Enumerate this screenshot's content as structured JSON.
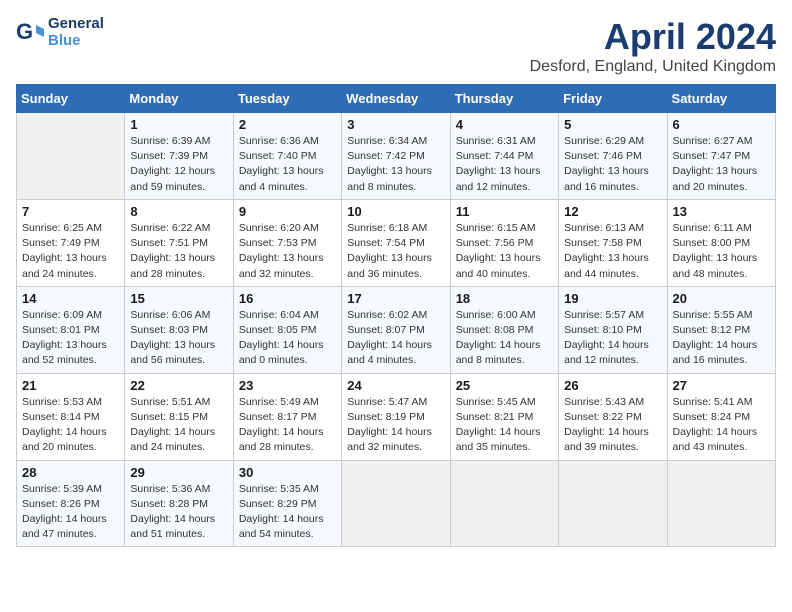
{
  "header": {
    "logo_line1": "General",
    "logo_line2": "Blue",
    "title": "April 2024",
    "subtitle": "Desford, England, United Kingdom"
  },
  "weekdays": [
    "Sunday",
    "Monday",
    "Tuesday",
    "Wednesday",
    "Thursday",
    "Friday",
    "Saturday"
  ],
  "weeks": [
    [
      {
        "day": "",
        "info": ""
      },
      {
        "day": "1",
        "info": "Sunrise: 6:39 AM\nSunset: 7:39 PM\nDaylight: 12 hours\nand 59 minutes."
      },
      {
        "day": "2",
        "info": "Sunrise: 6:36 AM\nSunset: 7:40 PM\nDaylight: 13 hours\nand 4 minutes."
      },
      {
        "day": "3",
        "info": "Sunrise: 6:34 AM\nSunset: 7:42 PM\nDaylight: 13 hours\nand 8 minutes."
      },
      {
        "day": "4",
        "info": "Sunrise: 6:31 AM\nSunset: 7:44 PM\nDaylight: 13 hours\nand 12 minutes."
      },
      {
        "day": "5",
        "info": "Sunrise: 6:29 AM\nSunset: 7:46 PM\nDaylight: 13 hours\nand 16 minutes."
      },
      {
        "day": "6",
        "info": "Sunrise: 6:27 AM\nSunset: 7:47 PM\nDaylight: 13 hours\nand 20 minutes."
      }
    ],
    [
      {
        "day": "7",
        "info": "Sunrise: 6:25 AM\nSunset: 7:49 PM\nDaylight: 13 hours\nand 24 minutes."
      },
      {
        "day": "8",
        "info": "Sunrise: 6:22 AM\nSunset: 7:51 PM\nDaylight: 13 hours\nand 28 minutes."
      },
      {
        "day": "9",
        "info": "Sunrise: 6:20 AM\nSunset: 7:53 PM\nDaylight: 13 hours\nand 32 minutes."
      },
      {
        "day": "10",
        "info": "Sunrise: 6:18 AM\nSunset: 7:54 PM\nDaylight: 13 hours\nand 36 minutes."
      },
      {
        "day": "11",
        "info": "Sunrise: 6:15 AM\nSunset: 7:56 PM\nDaylight: 13 hours\nand 40 minutes."
      },
      {
        "day": "12",
        "info": "Sunrise: 6:13 AM\nSunset: 7:58 PM\nDaylight: 13 hours\nand 44 minutes."
      },
      {
        "day": "13",
        "info": "Sunrise: 6:11 AM\nSunset: 8:00 PM\nDaylight: 13 hours\nand 48 minutes."
      }
    ],
    [
      {
        "day": "14",
        "info": "Sunrise: 6:09 AM\nSunset: 8:01 PM\nDaylight: 13 hours\nand 52 minutes."
      },
      {
        "day": "15",
        "info": "Sunrise: 6:06 AM\nSunset: 8:03 PM\nDaylight: 13 hours\nand 56 minutes."
      },
      {
        "day": "16",
        "info": "Sunrise: 6:04 AM\nSunset: 8:05 PM\nDaylight: 14 hours\nand 0 minutes."
      },
      {
        "day": "17",
        "info": "Sunrise: 6:02 AM\nSunset: 8:07 PM\nDaylight: 14 hours\nand 4 minutes."
      },
      {
        "day": "18",
        "info": "Sunrise: 6:00 AM\nSunset: 8:08 PM\nDaylight: 14 hours\nand 8 minutes."
      },
      {
        "day": "19",
        "info": "Sunrise: 5:57 AM\nSunset: 8:10 PM\nDaylight: 14 hours\nand 12 minutes."
      },
      {
        "day": "20",
        "info": "Sunrise: 5:55 AM\nSunset: 8:12 PM\nDaylight: 14 hours\nand 16 minutes."
      }
    ],
    [
      {
        "day": "21",
        "info": "Sunrise: 5:53 AM\nSunset: 8:14 PM\nDaylight: 14 hours\nand 20 minutes."
      },
      {
        "day": "22",
        "info": "Sunrise: 5:51 AM\nSunset: 8:15 PM\nDaylight: 14 hours\nand 24 minutes."
      },
      {
        "day": "23",
        "info": "Sunrise: 5:49 AM\nSunset: 8:17 PM\nDaylight: 14 hours\nand 28 minutes."
      },
      {
        "day": "24",
        "info": "Sunrise: 5:47 AM\nSunset: 8:19 PM\nDaylight: 14 hours\nand 32 minutes."
      },
      {
        "day": "25",
        "info": "Sunrise: 5:45 AM\nSunset: 8:21 PM\nDaylight: 14 hours\nand 35 minutes."
      },
      {
        "day": "26",
        "info": "Sunrise: 5:43 AM\nSunset: 8:22 PM\nDaylight: 14 hours\nand 39 minutes."
      },
      {
        "day": "27",
        "info": "Sunrise: 5:41 AM\nSunset: 8:24 PM\nDaylight: 14 hours\nand 43 minutes."
      }
    ],
    [
      {
        "day": "28",
        "info": "Sunrise: 5:39 AM\nSunset: 8:26 PM\nDaylight: 14 hours\nand 47 minutes."
      },
      {
        "day": "29",
        "info": "Sunrise: 5:36 AM\nSunset: 8:28 PM\nDaylight: 14 hours\nand 51 minutes."
      },
      {
        "day": "30",
        "info": "Sunrise: 5:35 AM\nSunset: 8:29 PM\nDaylight: 14 hours\nand 54 minutes."
      },
      {
        "day": "",
        "info": ""
      },
      {
        "day": "",
        "info": ""
      },
      {
        "day": "",
        "info": ""
      },
      {
        "day": "",
        "info": ""
      }
    ]
  ]
}
